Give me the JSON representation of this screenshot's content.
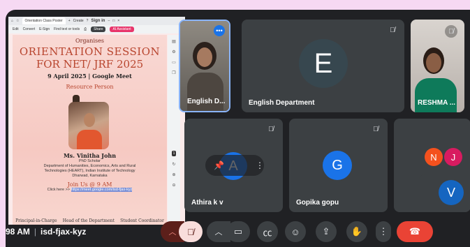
{
  "browser": {
    "tab_label": "Orientation Class Poster",
    "tab2_label": "Create",
    "signin": "Sign in",
    "toolbar": [
      "Edit",
      "Convert",
      "E-Sign",
      "Find text or tools"
    ],
    "share_label": "Share",
    "ai_label": "AI Assistant"
  },
  "poster": {
    "organises": "Organises",
    "title_line1": "ORIENTATION SESSION",
    "title_line2": "FOR NET/ JRF 2025",
    "date": "9 April 2025 | Google Meet",
    "resource_person": "Resource Person",
    "speaker_name": "Ms. Vinitha John",
    "speaker_role": "PhD Scholar",
    "speaker_dept": "Department of Humanities, Economics, Arts and Rural",
    "speaker_inst": "Technologies (HEART), Indian Institute of Technology",
    "speaker_place": "Dharwad, Karnataka",
    "join": "Join Us @ 9 AM",
    "click_prefix": "Click here >>",
    "link": "https://meet.google.com/isd-fjax-kyz",
    "footer": [
      "Principal-in-Charge",
      "Head of the Department",
      "Student Coordinator"
    ],
    "page_badge": "1"
  },
  "participants": [
    {
      "name": "English D...",
      "type": "video"
    },
    {
      "name": "English Department",
      "initial": "E",
      "avatar_color": "#37474f"
    },
    {
      "name": "RESHMA ...",
      "type": "video"
    },
    {
      "name": "Athira k v",
      "initial": "A",
      "avatar_color": "#1a73e8"
    },
    {
      "name": "Gopika gopu",
      "initial": "G",
      "avatar_color": "#1a73e8"
    },
    {
      "name": "",
      "initial": "N",
      "avatar_color": "#f4511e"
    },
    {
      "name": "",
      "initial": "J",
      "avatar_color": "#d81b60"
    },
    {
      "name": "",
      "initial": "V",
      "avatar_color": "#1565c0"
    }
  ],
  "meeting": {
    "time": "98 AM",
    "code": "isd-fjax-kyz"
  },
  "colors": {
    "end_call": "#ea4335",
    "accent": "#1a73e8"
  }
}
